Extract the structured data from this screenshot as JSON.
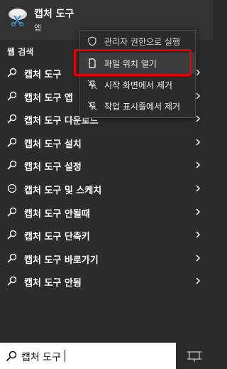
{
  "app": {
    "title": "캡처 도구",
    "subtitle": "앱"
  },
  "section_label": "웹 검색",
  "results": [
    {
      "label": "캡처 도구 ",
      "icon": "search-icon"
    },
    {
      "label": "캡처 도구 앱",
      "icon": "search-icon"
    },
    {
      "label": "캡처 도구 다운로드",
      "icon": "search-icon"
    },
    {
      "label": "캡처 도구 설치",
      "icon": "search-icon"
    },
    {
      "label": "캡처 도구 설정",
      "icon": "search-icon"
    },
    {
      "label": "캡처 도구 및 스케치",
      "icon": "chat-icon"
    },
    {
      "label": "캡처 도구 안될때",
      "icon": "search-icon"
    },
    {
      "label": "캡처 도구 단축키",
      "icon": "search-icon"
    },
    {
      "label": "캡처 도구 바로가기",
      "icon": "search-icon"
    },
    {
      "label": "캡처 도구 안됨",
      "icon": "search-icon"
    }
  ],
  "context_menu": {
    "items": [
      {
        "label": "관리자 권한으로 실행",
        "icon": "shield-icon"
      },
      {
        "label": "파일 위치 열기",
        "icon": "folder-icon"
      },
      {
        "label": "시작 화면에서 제거",
        "icon": "unpin-icon"
      },
      {
        "label": "작업 표시줄에서 제거",
        "icon": "unpin-icon"
      }
    ]
  },
  "search": {
    "query": "캡처 도구"
  },
  "colors": {
    "background": "#2c2c2c",
    "highlight": "#e60000",
    "search_bg": "#ffffff"
  }
}
